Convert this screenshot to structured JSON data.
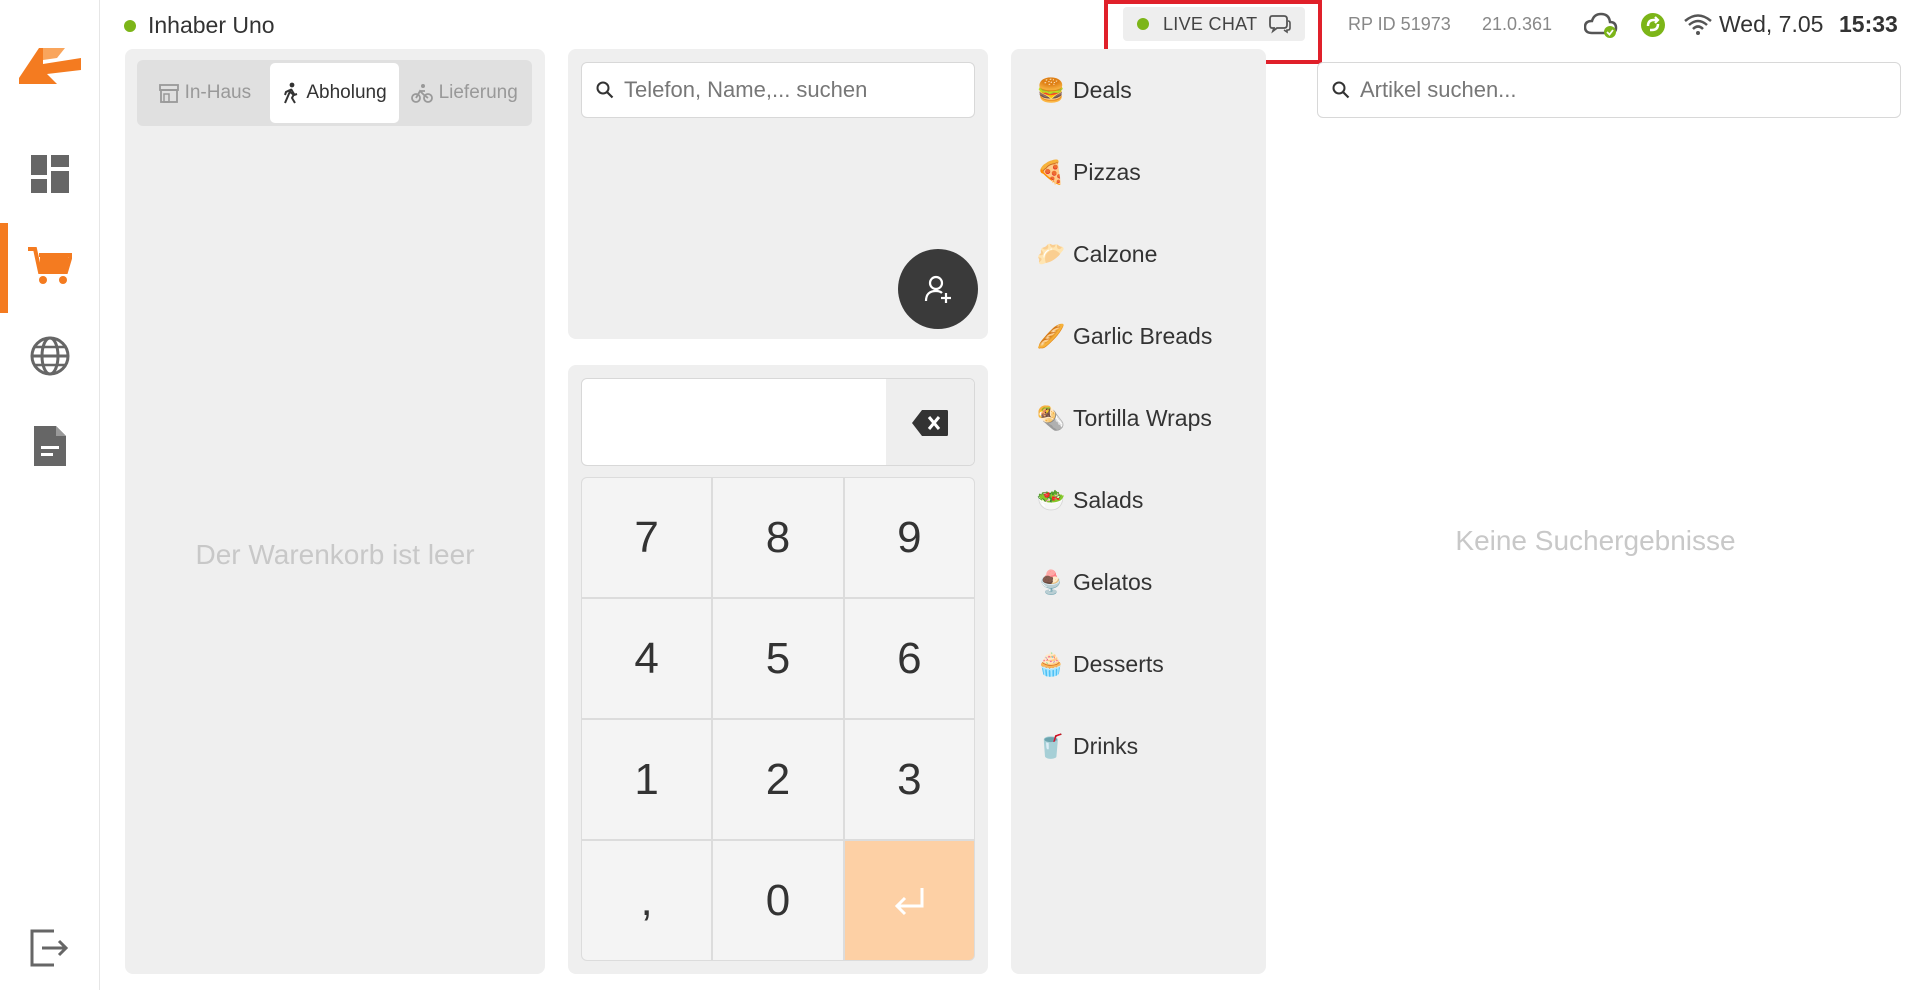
{
  "user": {
    "name": "Inhaber Uno",
    "status_color": "#7cb518"
  },
  "status_bar": {
    "live_chat_label": "LIVE CHAT",
    "rp_id": "RP ID 51973",
    "version": "21.0.361",
    "date": "Wed, 7.05",
    "time": "15:33"
  },
  "colors": {
    "accent": "#f47b20",
    "enter_key": "#fdd0a5",
    "online": "#7cb518",
    "highlight": "#e0202a"
  },
  "sidebar": {
    "items": [
      {
        "name": "dashboard",
        "icon": "dashboard-icon"
      },
      {
        "name": "cart",
        "icon": "cart-icon",
        "active": true
      },
      {
        "name": "web",
        "icon": "globe-icon"
      },
      {
        "name": "reports",
        "icon": "document-icon"
      },
      {
        "name": "logout",
        "icon": "logout-icon"
      }
    ]
  },
  "order_types": {
    "tabs": [
      {
        "label": "In-Haus",
        "icon": "store-icon"
      },
      {
        "label": "Abholung",
        "icon": "walking-icon",
        "active": true
      },
      {
        "label": "Lieferung",
        "icon": "bike-icon"
      }
    ]
  },
  "cart": {
    "empty_text": "Der Warenkorb ist leer"
  },
  "customer": {
    "search_placeholder": "Telefon, Name,... suchen"
  },
  "numpad": {
    "value": "",
    "keys": [
      "7",
      "8",
      "9",
      "4",
      "5",
      "6",
      "1",
      "2",
      "3",
      ",",
      "0",
      "↵"
    ]
  },
  "categories": [
    {
      "label": "Deals",
      "emoji": "🍔"
    },
    {
      "label": "Pizzas",
      "emoji": "🍕"
    },
    {
      "label": "Calzone",
      "emoji": "🥟"
    },
    {
      "label": "Garlic Breads",
      "emoji": "🥖"
    },
    {
      "label": "Tortilla Wraps",
      "emoji": "🌯"
    },
    {
      "label": "Salads",
      "emoji": "🥗"
    },
    {
      "label": "Gelatos",
      "emoji": "🍨"
    },
    {
      "label": "Desserts",
      "emoji": "🧁"
    },
    {
      "label": "Drinks",
      "emoji": "🥤"
    }
  ],
  "articles": {
    "search_placeholder": "Artikel suchen...",
    "no_results": "Keine Suchergebnisse"
  }
}
